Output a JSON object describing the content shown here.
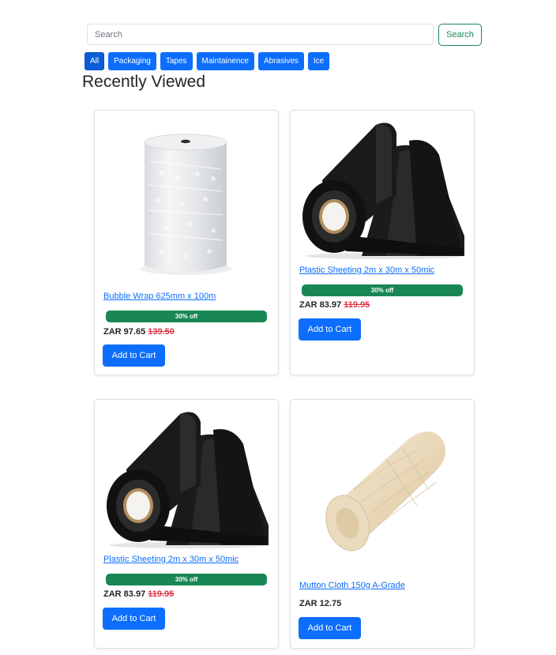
{
  "search": {
    "placeholder": "Search",
    "button_label": "Search"
  },
  "filters": [
    {
      "label": "All"
    },
    {
      "label": "Packaging"
    },
    {
      "label": "Tapes"
    },
    {
      "label": "Maintainence"
    },
    {
      "label": "Abrasives"
    },
    {
      "label": "Ice"
    }
  ],
  "section_title": "Recently Viewed",
  "products": [
    {
      "name": "Bubble Wrap 625mm x 100m",
      "badge": "30% off",
      "price": "ZAR 97.65",
      "old_price": "139.50",
      "cart_label": "Add to Cart",
      "image": "bubble-wrap-roll"
    },
    {
      "name": "Plastic Sheeting 2m x 30m x 50mic",
      "badge": "30% off",
      "price": "ZAR 83.97",
      "old_price": "119.95",
      "cart_label": "Add to Cart",
      "image": "black-plastic-sheeting-roll"
    },
    {
      "name": "Plastic Sheeting 2m x 30m x 50mic",
      "badge": "30% off",
      "price": "ZAR 83.97",
      "old_price": "119.95",
      "cart_label": "Add to Cart",
      "image": "black-plastic-sheeting-roll"
    },
    {
      "name": "Mutton Cloth 150g A-Grade",
      "price": "ZAR 12.75",
      "cart_label": "Add to Cart",
      "image": "mutton-cloth-roll"
    }
  ],
  "colors": {
    "primary": "#0d6efd",
    "success": "#198754",
    "danger": "#dc3545"
  }
}
